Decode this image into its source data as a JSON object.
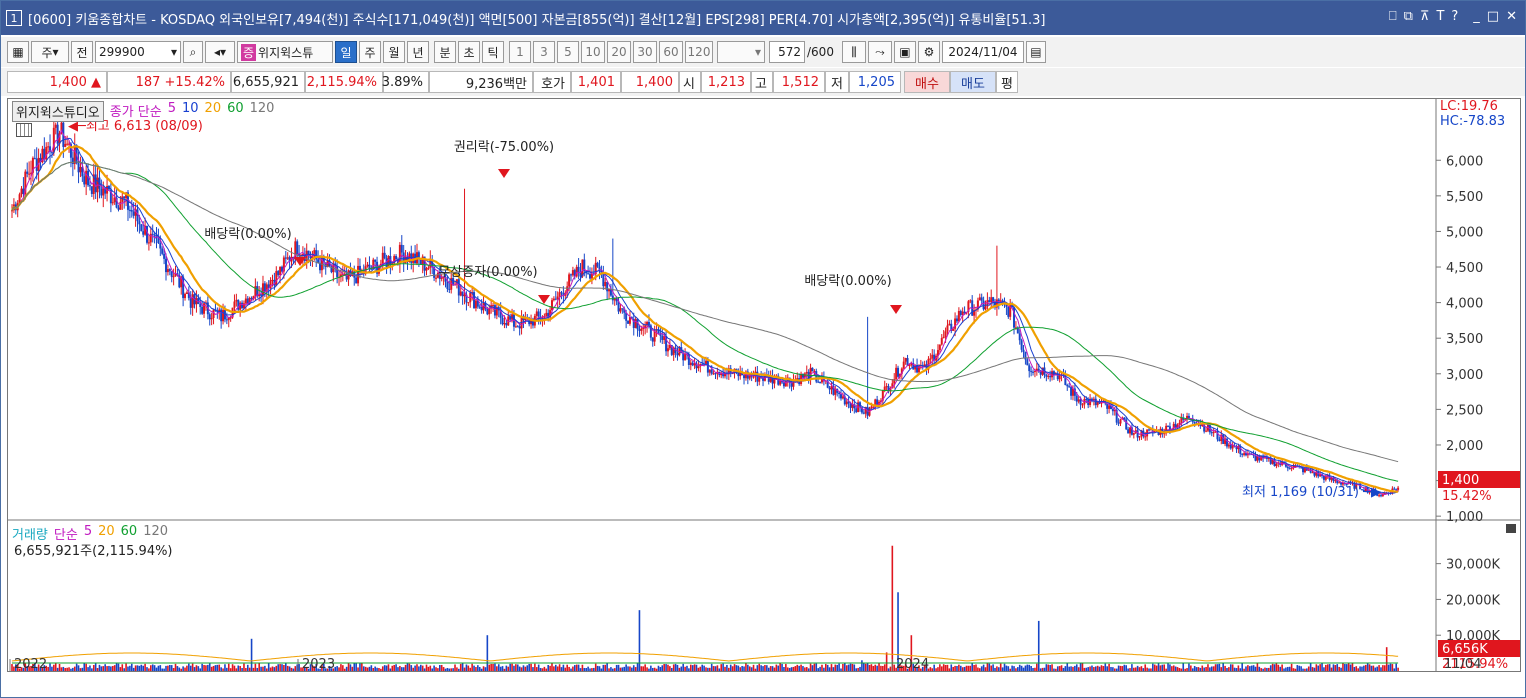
{
  "window": {
    "number": "1",
    "title": "[0600] 키움종합차트 - KOSDAQ 외국인보유[7,494(천)] 주식수[171,049(천)] 액면[500] 자본금[855(억)] 결산[12월] EPS[298] PER[4.70] 시가총액[2,395(억)] 유통비율[51.3]",
    "controls": [
      "⎕",
      "⧉",
      "⊼",
      "T",
      "?",
      "_",
      "□",
      "✕"
    ]
  },
  "toolbar": {
    "mode": "주",
    "jeon": "전",
    "code": "299900",
    "stock_name": "위지윅스튜",
    "periods": [
      "일",
      "주",
      "월",
      "년",
      "분",
      "초",
      "틱"
    ],
    "active_period": "일",
    "intervals": [
      "1",
      "3",
      "5",
      "10",
      "20",
      "30",
      "60",
      "120"
    ],
    "count": "572",
    "count_total": "/600",
    "date": "2024/11/04"
  },
  "quote": {
    "price": "1,400",
    "arrow": "▲",
    "change": "187",
    "change_pct": "+15.42%",
    "volume": "6,655,921",
    "volume_pct": "2,115.94%",
    "turnover": "3.89%",
    "amount": "9,236백만",
    "hoga_label": "호가",
    "ask": "1,401",
    "bid": "1,400",
    "open_label": "시",
    "open": "1,213",
    "high_label": "고",
    "high": "1,512",
    "low_label": "저",
    "low": "1,205",
    "buy_label": "매수",
    "sell_label": "매도",
    "pyeong_label": "평"
  },
  "price_panel": {
    "name_tag": "위지윅스튜디오",
    "ma_prefix": "종가 단순",
    "ma_periods": [
      "5",
      "10",
      "20",
      "60",
      "120"
    ],
    "ma_colors": [
      "#c01ac0",
      "#1840d0",
      "#f0a000",
      "#10a030",
      "#777777"
    ],
    "lc": "LC:19.76",
    "hc": "HC:-78.83",
    "high_marker": "최고 6,613 (08/09)",
    "low_marker": "최저 1,169 (10/31)",
    "events": [
      "권리락(-75.00%)",
      "배당락(0.00%)",
      "무상증자(0.00%)",
      "배당락(0.00%)"
    ],
    "y_ticks": [
      "6,000",
      "5,500",
      "5,000",
      "4,500",
      "4,000",
      "3,500",
      "3,000",
      "2,500",
      "2,000",
      "1,500",
      "1,000"
    ],
    "last_price": "1,400",
    "last_pct": "15.42%"
  },
  "volume_panel": {
    "title": "거래량",
    "ma_prefix": "단순",
    "ma_periods": [
      "5",
      "20",
      "60",
      "120"
    ],
    "summary": "6,655,921주(2,115.94%)",
    "y_ticks": [
      "30,000K",
      "20,000K",
      "10,000K"
    ],
    "last_volume": "6,656K",
    "last_pct": "2115.94%"
  },
  "x_axis": {
    "labels": [
      "2022",
      "2023",
      "2024",
      "11/04"
    ]
  },
  "chart_data": {
    "type": "candlestick",
    "y_range": [
      1000,
      6613
    ],
    "anchor_prices": [
      [
        0,
        5300
      ],
      [
        10,
        5900
      ],
      [
        25,
        6400
      ],
      [
        40,
        5700
      ],
      [
        60,
        5400
      ],
      [
        80,
        4600
      ],
      [
        95,
        4000
      ],
      [
        110,
        3800
      ],
      [
        125,
        4100
      ],
      [
        140,
        4400
      ],
      [
        150,
        4800
      ],
      [
        160,
        4600
      ],
      [
        175,
        4300
      ],
      [
        190,
        4500
      ],
      [
        205,
        4700
      ],
      [
        220,
        4500
      ],
      [
        235,
        4200
      ],
      [
        250,
        3900
      ],
      [
        265,
        3700
      ],
      [
        280,
        3800
      ],
      [
        290,
        4200
      ],
      [
        300,
        4500
      ],
      [
        310,
        4400
      ],
      [
        320,
        3900
      ],
      [
        335,
        3600
      ],
      [
        350,
        3300
      ],
      [
        365,
        3100
      ],
      [
        380,
        3000
      ],
      [
        395,
        2950
      ],
      [
        410,
        2900
      ],
      [
        420,
        3000
      ],
      [
        430,
        2800
      ],
      [
        440,
        2600
      ],
      [
        450,
        2450
      ],
      [
        460,
        2800
      ],
      [
        470,
        3200
      ],
      [
        480,
        3050
      ],
      [
        490,
        3500
      ],
      [
        500,
        3900
      ],
      [
        515,
        4000
      ],
      [
        525,
        3900
      ],
      [
        535,
        3100
      ],
      [
        550,
        3000
      ],
      [
        560,
        2650
      ],
      [
        575,
        2550
      ],
      [
        590,
        2150
      ],
      [
        605,
        2200
      ],
      [
        620,
        2400
      ],
      [
        635,
        2100
      ],
      [
        650,
        1850
      ],
      [
        665,
        1750
      ],
      [
        680,
        1650
      ],
      [
        695,
        1500
      ],
      [
        710,
        1400
      ],
      [
        720,
        1300
      ],
      [
        729,
        1400
      ]
    ],
    "spikes": [
      [
        238,
        5600
      ],
      [
        316,
        4900
      ],
      [
        450,
        3800
      ],
      [
        518,
        4800
      ]
    ],
    "ma": {
      "ma20_shift": 6,
      "ma60_shift": 18,
      "ma120_start": 3700,
      "ma120_end": 1620
    },
    "volume_spikes_k": [
      [
        126,
        9000
      ],
      [
        250,
        10000
      ],
      [
        330,
        17000
      ],
      [
        447,
        3000
      ],
      [
        460,
        5200
      ],
      [
        463,
        35000
      ],
      [
        466,
        22000
      ],
      [
        473,
        10000
      ],
      [
        540,
        14000
      ],
      [
        723,
        6656
      ]
    ]
  }
}
